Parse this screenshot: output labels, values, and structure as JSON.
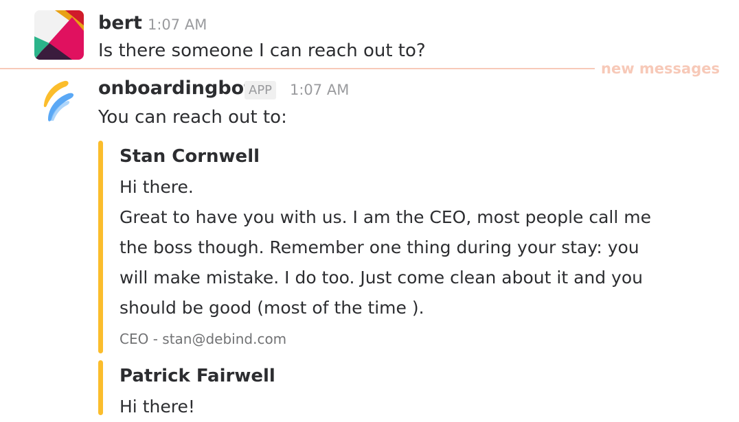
{
  "messages": [
    {
      "user": "bert",
      "time": "1:07 AM",
      "text": "Is there someone I can reach out to?"
    },
    {
      "user": "onboardingbot",
      "badge": "APP",
      "time": "1:07 AM",
      "text": "You can reach out to:",
      "attachments": [
        {
          "title": "Stan Cornwell",
          "lines": [
            "Hi there.",
            "Great to have you with us. I am the CEO, most people call me",
            "the boss though. Remember one thing during your stay: you",
            "will make mistake. I do too. Just come clean about it and you",
            "should be good (most of the time  )."
          ],
          "footer": "CEO - stan@debind.com",
          "color": "#fbbd2c"
        },
        {
          "title": "Patrick Fairwell",
          "lines": [
            "Hi there!"
          ],
          "color": "#fbbd2c"
        }
      ]
    }
  ],
  "divider": {
    "label": "new messages",
    "color": "#f7c9b8"
  },
  "icons": {
    "bert_avatar": "multicolor-geometric-avatar-icon",
    "bot_avatar": "feather-logo-icon"
  }
}
